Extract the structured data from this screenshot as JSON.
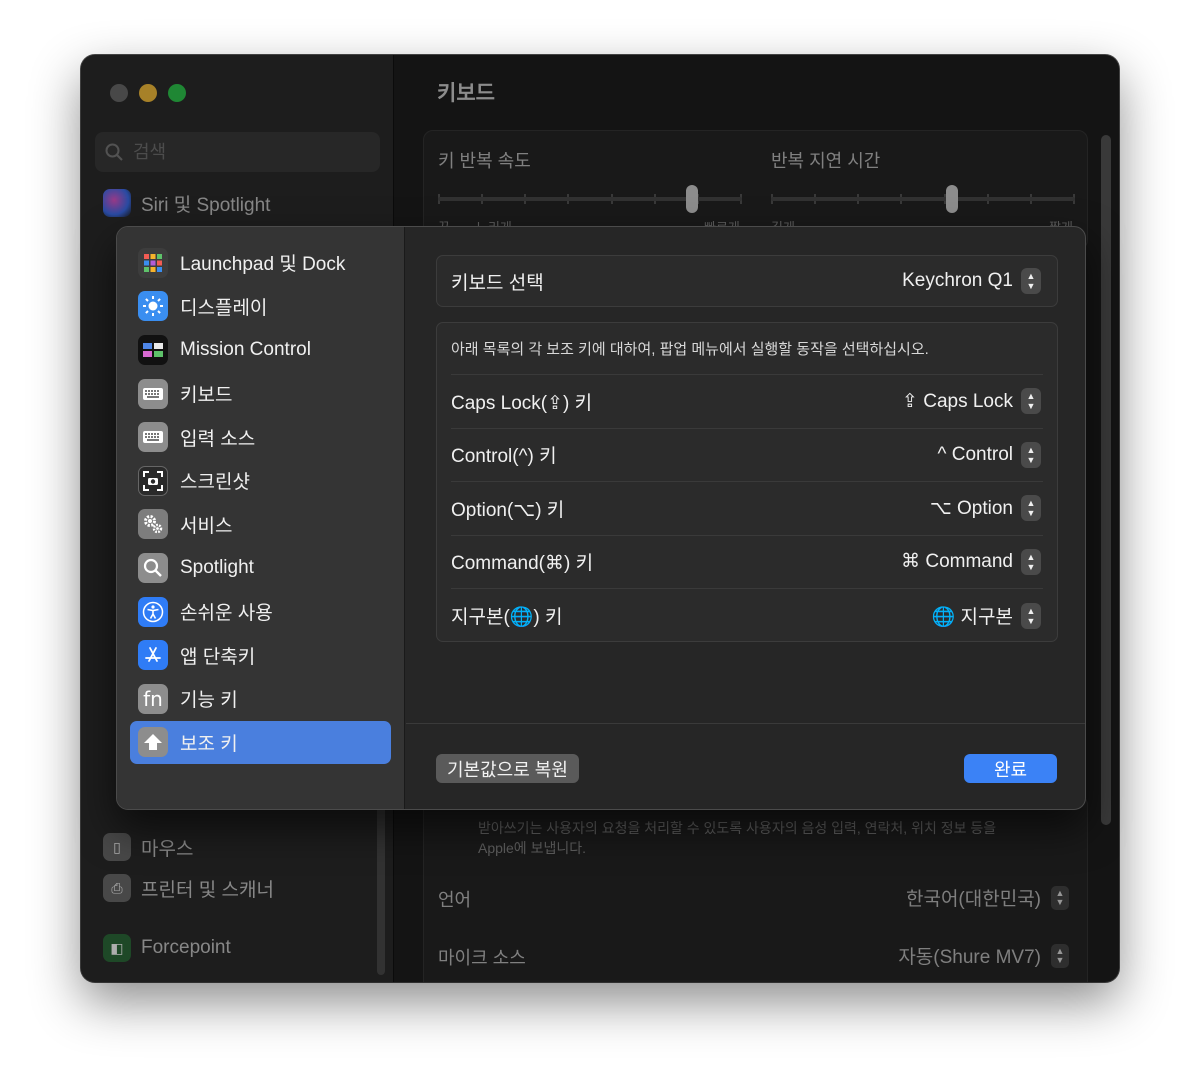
{
  "background": {
    "search_placeholder": "검색",
    "sidebar_items": [
      {
        "label": "Siri 및 Spotlight",
        "icon": "siri-icon"
      },
      {
        "label": "마우스",
        "icon": "mouse-icon"
      },
      {
        "label": "프린터 및 스캐너",
        "icon": "printer-icon"
      },
      {
        "label": "Forcepoint",
        "icon": "forcepoint-icon"
      }
    ],
    "main_title": "키보드",
    "repeat_rate_label": "키 반복 속도",
    "repeat_delay_label": "반복 지연 시간",
    "repeat_rate_min": "끔",
    "repeat_rate_slow": "느리게",
    "repeat_rate_fast": "빠르게",
    "repeat_delay_long": "길게",
    "repeat_delay_short": "짧게",
    "repeat_rate_level": 0.85,
    "repeat_delay_level": 0.6,
    "dictation_note_1": "받아쓰기는 사용자의 요청을 처리할 수 있도록 사용자의 음성 입력, 연락처, 위치 정보 등을",
    "dictation_note_2": "Apple에 보냅니다.",
    "language_label": "언어",
    "language_value": "한국어(대한민국)",
    "mic_label": "마이크 소스",
    "mic_value": "자동(Shure MV7)"
  },
  "sheet": {
    "nav": [
      {
        "label": "Launchpad 및 Dock",
        "icon": "launchpad-icon",
        "color": "#3a3a3a"
      },
      {
        "label": "디스플레이",
        "icon": "display-icon",
        "color": "#3a8ef0"
      },
      {
        "label": "Mission Control",
        "icon": "mission-control-icon",
        "color": "#1c1c1c"
      },
      {
        "label": "키보드",
        "icon": "keyboard-icon",
        "color": "#8a8a8a"
      },
      {
        "label": "입력 소스",
        "icon": "input-source-icon",
        "color": "#8a8a8a"
      },
      {
        "label": "스크린샷",
        "icon": "screenshot-icon",
        "color": "#2a2a2a"
      },
      {
        "label": "서비스",
        "icon": "gear-icon",
        "color": "#7d7d7d"
      },
      {
        "label": "Spotlight",
        "icon": "search-icon",
        "color": "#8d8d8d"
      },
      {
        "label": "손쉬운 사용",
        "icon": "accessibility-icon",
        "color": "#2f7cf6"
      },
      {
        "label": "앱 단축키",
        "icon": "app-store-icon",
        "color": "#2f7cf6"
      },
      {
        "label": "기능 키",
        "icon": "fn-icon",
        "color": "#8a8a8a"
      },
      {
        "label": "보조 키",
        "icon": "modifier-key-icon",
        "color": "#8a8a8a"
      }
    ],
    "active_index": 11,
    "keyboard_select_label": "키보드 선택",
    "keyboard_select_value": "Keychron Q1",
    "description": "아래 목록의 각 보조 키에 대하여, 팝업 메뉴에서 실행할 동작을 선택하십시오.",
    "modifiers": [
      {
        "label": "Caps Lock(⇪) 키",
        "value": "⇪ Caps Lock"
      },
      {
        "label": "Control(^) 키",
        "value": "^ Control"
      },
      {
        "label": "Option(⌥) 키",
        "value": "⌥ Option"
      },
      {
        "label": "Command(⌘) 키",
        "value": "⌘ Command"
      },
      {
        "label": "지구본(🌐) 키",
        "value": "🌐 지구본"
      }
    ],
    "reset_button": "기본값으로 복원",
    "done_button": "완료"
  }
}
